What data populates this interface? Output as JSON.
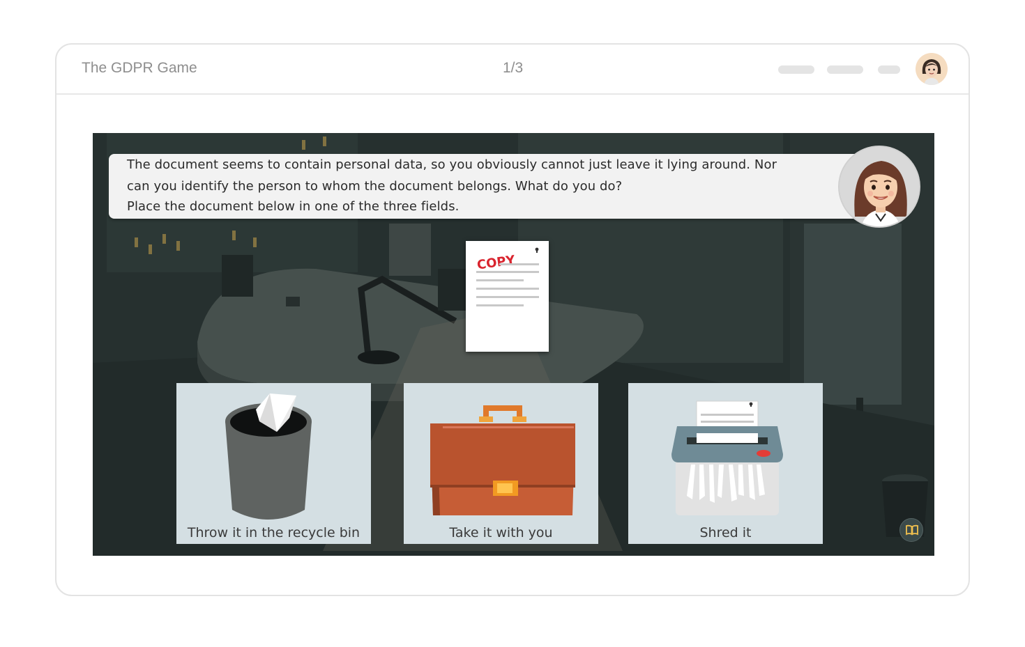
{
  "app": {
    "title": "The GDPR Game",
    "page_counter": "1/3"
  },
  "dialog": {
    "lines": [
      "The document seems to contain personal data, so you obviously cannot just leave it lying around. Nor",
      "can you identify the person to whom the document belongs. What do you do?",
      "Place the document below in one of the three fields."
    ]
  },
  "document": {
    "stamp_text": "COPY",
    "stamp_color": "#d9242e"
  },
  "drop_zones": [
    {
      "label": "Throw it in the recycle bin",
      "icon": "recycle-bin-icon"
    },
    {
      "label": "Take it with you",
      "icon": "briefcase-icon"
    },
    {
      "label": "Shred it",
      "icon": "shredder-icon"
    }
  ],
  "colors": {
    "zone_background": "#d4dfe3",
    "dialog_background": "#f2f2f2",
    "scene_background": "#273230",
    "briefcase": "#c65d36",
    "shredder": "#6f8b96"
  }
}
